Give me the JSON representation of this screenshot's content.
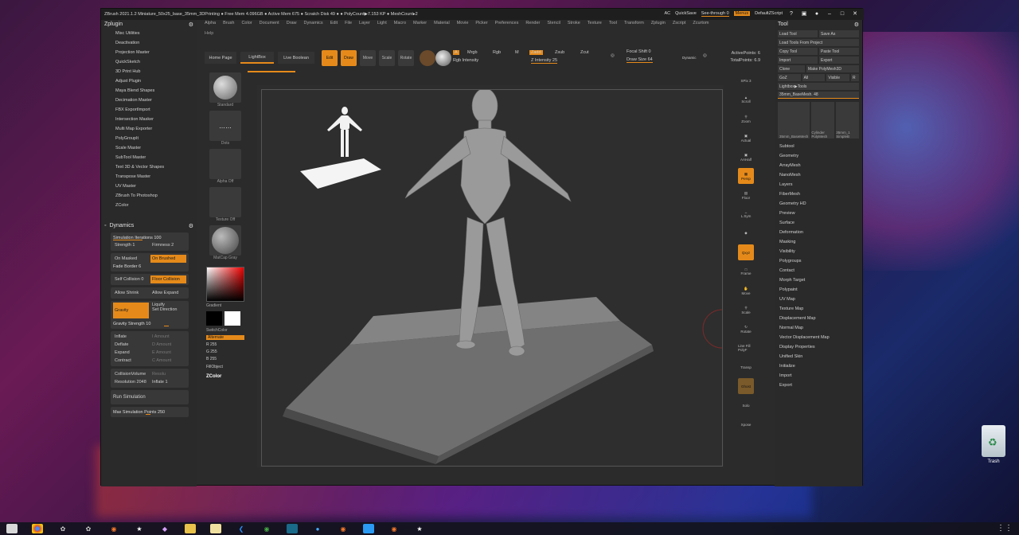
{
  "titlebar": {
    "title": "ZBrush 2021.1.2   Miniature_50x25_base_35mm_3DPrinting  ● Free Mem 4.096GB ● Active Mem 675 ● Scratch Disk 49 ● ● PolyCount▶7.153 KP ● MeshCount▸2",
    "ac": "AC",
    "quicksave": "QuickSave",
    "see_through": "See-through  0",
    "menus": "Menus",
    "default_script": "DefaultZScript"
  },
  "menubar": [
    "Alpha",
    "Brush",
    "Color",
    "Document",
    "Draw",
    "Dynamics",
    "Edit",
    "File",
    "Layer",
    "Light",
    "Macro",
    "Marker",
    "Material",
    "Movie",
    "Picker",
    "Preferences",
    "Render",
    "Stencil",
    "Stroke",
    "Texture",
    "Tool",
    "Transform",
    "Zplugin",
    "Zscript",
    "Zcurtom"
  ],
  "help": "Help",
  "zplugin": {
    "title": "Zplugin",
    "items": [
      "Misc Utilities",
      "Deactivation",
      "Projection Master",
      "QuickSketch",
      "3D Print Hub",
      "Adjust Plugin",
      "Maya Blend Shapes",
      "Decimation Master",
      "FBX ExportImport",
      "Intersection Masker",
      "Multi Map Exporter",
      "PolyGroupIt",
      "Scale Master",
      "SubTool Master",
      "Text 3D & Vector Shapes",
      "Transpose Master",
      "UV Master",
      "ZBrush To Photoshop",
      "ZColor"
    ]
  },
  "dynamics": {
    "title": "Dynamics",
    "sim_iterations": "Simulation Iterations 100",
    "strength": "Strength 1",
    "firmness": "Firmness 2",
    "on_masked": "On Masked",
    "on_brushed": "On Brushed",
    "fade_border": "Fade Border 6",
    "self_collision": "Self Collision 0",
    "floor_collision": "Floor Collision",
    "allow_shrink": "Allow Shrink",
    "allow_expand": "Allow Expand",
    "gravity": "Gravity",
    "liquify": "Liquify",
    "set_direction": "Set Direction",
    "gravity_strength": "Gravity Strength 10",
    "inflate": "Inflate",
    "deflate": "Deflate",
    "expand": "Expand",
    "contract": "Contract",
    "i_amount": "I Amount",
    "d_amount": "D Amount",
    "e_amount": "E Amount",
    "c_amount": "C Amount",
    "collision_volume": "CollisionVolume",
    "resolu": "Resolu",
    "resolution": "Resolution 2048",
    "inflate1": "Inflate 1",
    "run_simulation": "Run Simulation",
    "max_sim_points": "Max Simulation Points 250"
  },
  "shelf": {
    "home_page": "Home Page",
    "lightbox": "LightBox",
    "live_boolean": "Live Boolean",
    "edit": "Edit",
    "draw": "Draw",
    "move": "Move",
    "scale": "Scale",
    "rotate": "Rotate",
    "a": "A",
    "mrgb": "Mrgb",
    "rgb": "Rgb",
    "m": "M",
    "rgb_intensity": "Rgb Intensity",
    "zadd": "Zadd",
    "zsub": "Zsub",
    "zcut": "Zcut",
    "z_intensity": "Z Intensity 25",
    "focal_shift": "Focal Shift 0",
    "draw_size": "Draw Size 64",
    "dynamic": "Dynamic",
    "progress": 0.5
  },
  "stats": {
    "active_points": "ActivePoints: 6",
    "total_points": "TotalPoints: 6.9"
  },
  "materials": {
    "standard": "Standard",
    "dots": "Dots",
    "alpha_off": "Alpha Off",
    "texture_off": "Texture Off",
    "matcap_gray": "MatCap Gray",
    "gradient": "Gradient",
    "switch_color": "SwitchColor",
    "alternate": "Alternate",
    "r": "R 255",
    "g": "G 255",
    "b": "B 255",
    "fill_object": "FillObject",
    "zcolor": "ZColor"
  },
  "right_icons": [
    "SPix 3",
    "Scroll",
    "Zoom",
    "Actual",
    "AAHalf",
    "Persp",
    "Floor",
    "L.Sym",
    "Qxyz",
    "Frame",
    "Move",
    "Scale",
    "Rotate",
    "Line Fill PolyF",
    "Transp",
    "Ghost",
    "Solo",
    "Xpose"
  ],
  "tool": {
    "title": "Tool",
    "load_tool": "Load Tool",
    "save_as": "Save As",
    "load_from_project": "Load Tools From Project",
    "copy_tool": "Copy Tool",
    "paste_tool": "Paste Tool",
    "import": "Import",
    "export": "Export",
    "clone": "Clone",
    "make_polymesh": "Make PolyMesh3D",
    "goz": "GoZ",
    "all": "All",
    "visible": "Visible",
    "r": "R",
    "lightbox_tools": "Lightbox▶Tools",
    "current": "35mm_BaseMesh. 48",
    "thumb1": "35mm_BaseMesh",
    "thumb2": "Cylinder PolyMesh",
    "thumb3": "35mm_1 SimpleB",
    "items": [
      "Subtool",
      "Geometry",
      "ArrayMesh",
      "NanoMesh",
      "Layers",
      "FiberMesh",
      "Geometry HD",
      "Preview",
      "Surface",
      "Deformation",
      "Masking",
      "Visibility",
      "Polygroups",
      "Contact",
      "Morph Target",
      "Polypaint",
      "UV Map",
      "Texture Map",
      "Displacement Map",
      "Normal Map",
      "Vector Displacement Map",
      "Display Properties",
      "Unified Skin",
      "Initialize",
      "Import",
      "Export"
    ]
  },
  "desktop": {
    "trash": "Trash"
  }
}
